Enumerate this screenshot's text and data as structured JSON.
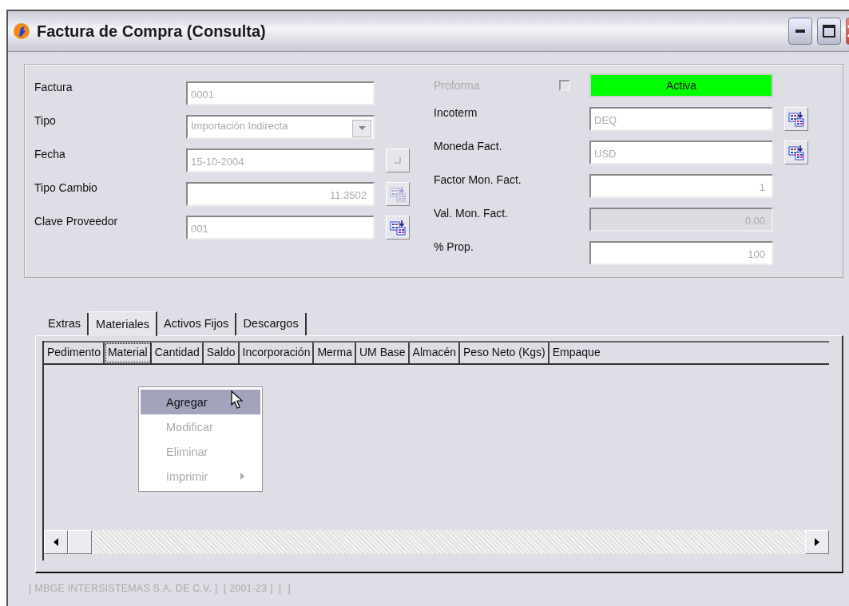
{
  "window": {
    "title": "Factura de Compra (Consulta)"
  },
  "left_fields": [
    {
      "label": "Factura",
      "value": "0001",
      "kind": "text",
      "numeric": false,
      "disabled": false
    },
    {
      "label": "Tipo",
      "value": "Importación Indirecta",
      "kind": "dropdown",
      "numeric": false,
      "disabled": false
    },
    {
      "label": "Fecha",
      "value": "15-10-2004",
      "kind": "text",
      "numeric": false,
      "disabled": false,
      "button": {
        "kind": "calendar",
        "disabled": false
      }
    },
    {
      "label": "Tipo Cambio",
      "value": "11.3502",
      "kind": "text",
      "numeric": true,
      "disabled": false,
      "button": {
        "kind": "lookup",
        "disabled": true
      }
    },
    {
      "label": "Clave Proveedor",
      "value": "001",
      "kind": "text",
      "numeric": false,
      "disabled": false,
      "button": {
        "kind": "lookup",
        "disabled": false
      }
    }
  ],
  "proforma": {
    "label": "Proforma",
    "checked": false,
    "disabled": true
  },
  "status": {
    "text": "Activa",
    "color": "#00ff00"
  },
  "right_fields": [
    {
      "label": "Incoterm",
      "value": "DEQ",
      "kind": "text",
      "numeric": false,
      "disabled": false,
      "button": {
        "kind": "lookup",
        "disabled": false
      }
    },
    {
      "label": "Moneda Fact.",
      "value": "USD",
      "kind": "text",
      "numeric": false,
      "disabled": false,
      "button": {
        "kind": "lookup",
        "disabled": false
      }
    },
    {
      "label": "Factor Mon. Fact.",
      "value": "1",
      "kind": "text",
      "numeric": true,
      "disabled": false
    },
    {
      "label": "Val. Mon. Fact.",
      "value": "0.00",
      "kind": "text",
      "numeric": true,
      "disabled": true
    },
    {
      "label": "% Prop.",
      "value": "100",
      "kind": "text",
      "numeric": true,
      "disabled": false
    }
  ],
  "tabs": [
    {
      "label": "Extras",
      "selected": false
    },
    {
      "label": "Materiales",
      "selected": true
    },
    {
      "label": "Activos Fijos",
      "selected": false
    },
    {
      "label": "Descargos",
      "selected": false
    }
  ],
  "table": {
    "columns": [
      {
        "label": "Pedimento",
        "selected": false
      },
      {
        "label": "Material",
        "selected": true
      },
      {
        "label": "Cantidad",
        "selected": false
      },
      {
        "label": "Saldo",
        "selected": false
      },
      {
        "label": "Incorporación",
        "selected": false
      },
      {
        "label": "Merma",
        "selected": false
      },
      {
        "label": "UM Base",
        "selected": false
      },
      {
        "label": "Almacén",
        "selected": false
      },
      {
        "label": "Peso Neto (Kgs)",
        "selected": false
      },
      {
        "label": "Empaque",
        "selected": false
      }
    ]
  },
  "context_menu": {
    "items": [
      {
        "label": "Agregar",
        "selected": true,
        "disabled": false,
        "submenu": false
      },
      {
        "label": "Modificar",
        "selected": false,
        "disabled": true,
        "submenu": false
      },
      {
        "label": "Eliminar",
        "selected": false,
        "disabled": true,
        "submenu": false
      },
      {
        "label": "Imprimir",
        "selected": false,
        "disabled": true,
        "submenu": true
      }
    ]
  },
  "status_bar": {
    "text": "[ MBGE INTERSISTEMAS S.A. DE C.V. ]  [ 2001-23 ]  [  ]"
  }
}
